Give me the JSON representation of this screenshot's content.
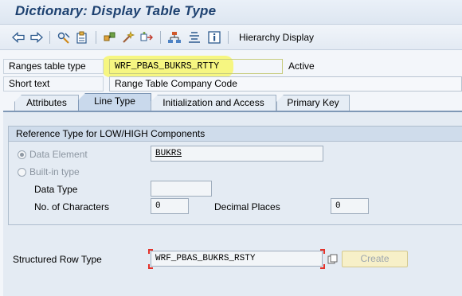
{
  "title": "Dictionary: Display Table Type",
  "toolbar": {
    "hierarchy_label": "Hierarchy Display",
    "icons": [
      "back-arrow-icon",
      "forward-arrow-icon",
      "display-change-icon",
      "other-object-icon",
      "active-inactive-icon",
      "where-used-icon",
      "object-list-icon",
      "hierarchy-icon",
      "documentation-icon",
      "info-icon"
    ]
  },
  "header": {
    "type_label": "Ranges table type",
    "type_value": "WRF_PBAS_BUKRS_RTTY",
    "status": "Active",
    "short_text_label": "Short text",
    "short_text_value": "Range Table Company Code"
  },
  "tabs": [
    {
      "label": "Attributes",
      "active": false
    },
    {
      "label": "Line Type",
      "active": true
    },
    {
      "label": "Initialization and Access",
      "active": false
    },
    {
      "label": "Primary Key",
      "active": false
    }
  ],
  "reference": {
    "group_title": "Reference Type for LOW/HIGH Components",
    "data_element_label": "Data Element",
    "data_element_value": "BUKRS",
    "builtin_label": "Built-in type",
    "data_type_label": "Data Type",
    "data_type_value": "",
    "chars_label": "No. of Characters",
    "chars_value": "0",
    "decimals_label": "Decimal Places",
    "decimals_value": "0"
  },
  "row_type": {
    "label": "Structured Row Type",
    "value": "WRF_PBAS_BUKRS_RSTY",
    "create_label": "Create"
  },
  "colors": {
    "title": "#1d4170",
    "highlight": "#f6f57a",
    "required": "#e3332b"
  }
}
